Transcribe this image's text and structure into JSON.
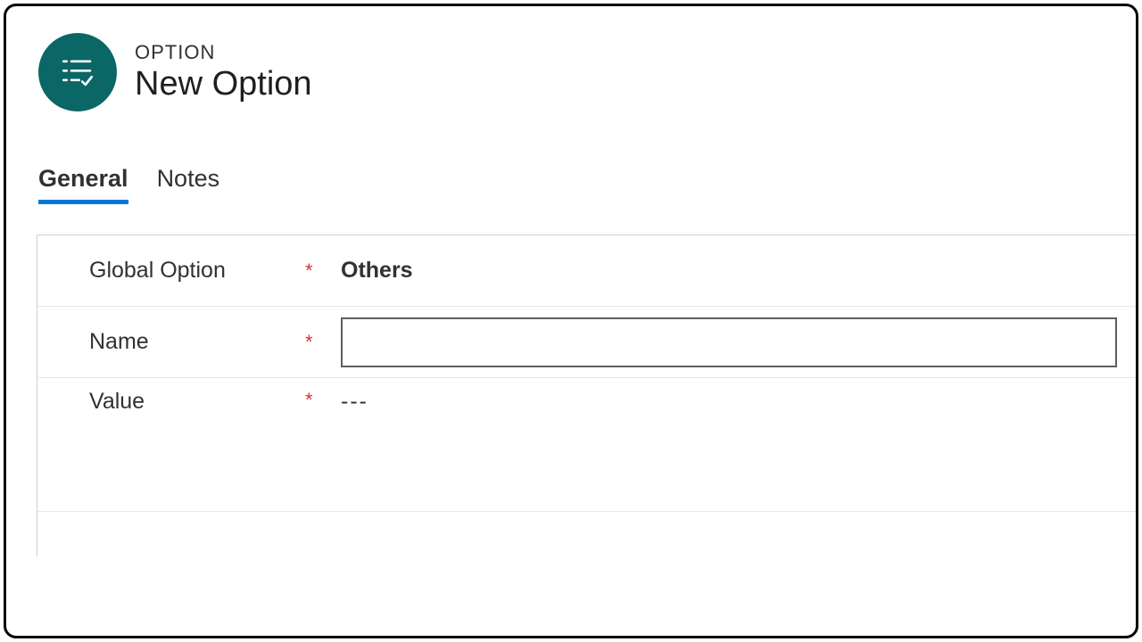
{
  "header": {
    "entity_type": "OPTION",
    "title": "New Option"
  },
  "tabs": [
    {
      "label": "General",
      "active": true
    },
    {
      "label": "Notes",
      "active": false
    }
  ],
  "required_marker": "*",
  "fields": {
    "global_option": {
      "label": "Global Option",
      "value": "Others"
    },
    "name": {
      "label": "Name",
      "value": ""
    },
    "value": {
      "label": "Value",
      "display": "---"
    }
  }
}
